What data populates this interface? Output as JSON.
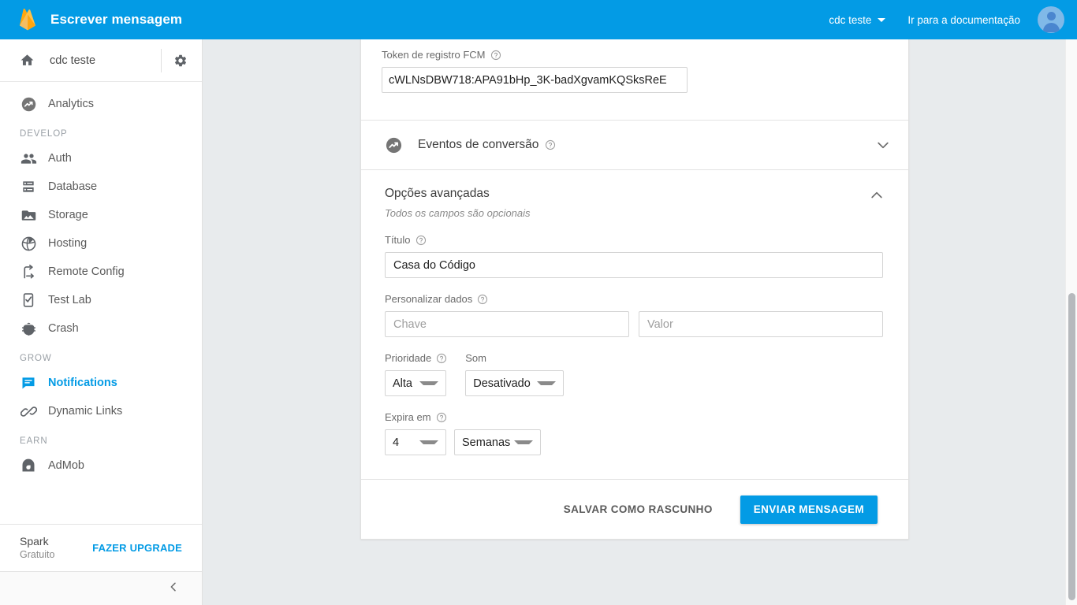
{
  "topbar": {
    "title": "Escrever mensagem",
    "logo_icon": "firebase-flame-icon",
    "project_label": "cdc teste",
    "caret_icon": "chevron-down-icon",
    "docs_link": "Ir para a documentação",
    "avatar_icon": "user-avatar-icon"
  },
  "sidebar": {
    "home_icon": "home-icon",
    "project_name": "cdc teste",
    "settings_icon": "gear-icon",
    "top_items": [
      {
        "label": "Analytics",
        "icon": "analytics-icon",
        "active": false
      }
    ],
    "sections": [
      {
        "title": "DEVELOP",
        "items": [
          {
            "label": "Auth",
            "icon": "people-icon",
            "active": false
          },
          {
            "label": "Database",
            "icon": "database-icon",
            "active": false
          },
          {
            "label": "Storage",
            "icon": "storage-image-icon",
            "active": false
          },
          {
            "label": "Hosting",
            "icon": "hosting-globe-icon",
            "active": false
          },
          {
            "label": "Remote Config",
            "icon": "remote-config-icon",
            "active": false
          },
          {
            "label": "Test Lab",
            "icon": "test-lab-icon",
            "active": false
          },
          {
            "label": "Crash",
            "icon": "crash-bug-icon",
            "active": false
          }
        ]
      },
      {
        "title": "GROW",
        "items": [
          {
            "label": "Notifications",
            "icon": "notifications-message-icon",
            "active": true
          },
          {
            "label": "Dynamic Links",
            "icon": "dynamic-links-chain-icon",
            "active": false
          }
        ]
      },
      {
        "title": "EARN",
        "items": [
          {
            "label": "AdMob",
            "icon": "admob-icon",
            "active": false
          }
        ]
      }
    ],
    "plan": {
      "name": "Spark",
      "subtitle": "Gratuito",
      "upgrade_label": "FAZER UPGRADE"
    },
    "collapse_icon": "chevron-left-icon"
  },
  "main": {
    "token_section": {
      "label": "Token de registro FCM",
      "help_icon": "help-circle-icon",
      "value": "cWLNsDBW718:APA91bHp_3K-badXgvamKQSksReE"
    },
    "conversion_section": {
      "icon": "analytics-icon",
      "title": "Eventos de conversão",
      "help_icon": "help-circle-icon",
      "expand_icon": "chevron-down-icon",
      "expanded": false
    },
    "advanced_section": {
      "title": "Opções avançadas",
      "subtitle": "Todos os campos são opcionais",
      "collapse_icon": "chevron-up-icon",
      "expanded": true,
      "title_field": {
        "label": "Título",
        "help_icon": "help-circle-icon",
        "value": "Casa do Código"
      },
      "custom_data": {
        "label": "Personalizar dados",
        "help_icon": "help-circle-icon",
        "key_placeholder": "Chave",
        "key_value": "",
        "value_placeholder": "Valor",
        "value_value": ""
      },
      "priority": {
        "label": "Prioridade",
        "help_icon": "help-circle-icon",
        "selected": "Alta",
        "caret_icon": "chevron-down-icon"
      },
      "sound": {
        "label": "Som",
        "selected": "Desativado",
        "caret_icon": "chevron-down-icon"
      },
      "expires": {
        "label": "Expira em",
        "help_icon": "help-circle-icon",
        "amount": "4",
        "amount_caret_icon": "chevron-down-icon",
        "unit": "Semanas",
        "unit_caret_icon": "chevron-down-icon"
      }
    },
    "actions": {
      "draft_label": "SALVAR COMO RASCUNHO",
      "send_label": "ENVIAR MENSAGEM"
    }
  },
  "colors": {
    "brand_blue": "#039BE5",
    "page_bg": "#e8ebed",
    "card_bg": "#ffffff",
    "text_primary": "#3c3c3c",
    "text_secondary": "#6b6b6b"
  }
}
